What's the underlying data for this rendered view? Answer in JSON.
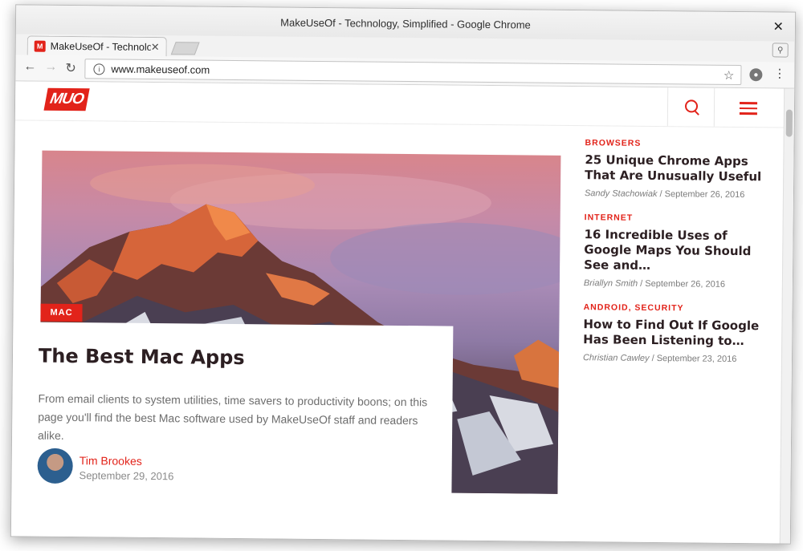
{
  "window": {
    "title": "MakeUseOf - Technology, Simplified - Google Chrome",
    "close_glyph": "✕"
  },
  "tab": {
    "favicon_text": "M",
    "title": "MakeUseOf - Technology, Simplified",
    "close_glyph": "✕"
  },
  "toolbar": {
    "back_glyph": "←",
    "forward_glyph": "→",
    "reload_glyph": "↻",
    "url": "www.makeuseof.com",
    "info_glyph": "i",
    "star_glyph": "☆",
    "menu_glyph": "⋮",
    "profile_glyph": "⚲"
  },
  "site": {
    "logo_text": "MUO",
    "brand_color": "#e2231a"
  },
  "featured": {
    "category": "MAC",
    "title": "The Best Mac Apps",
    "description": "From email clients to system utilities, time savers to productivity boons; on this page you'll find the best Mac software used by MakeUseOf staff and readers alike.",
    "author": "Tim Brookes",
    "date": "September 29, 2016"
  },
  "sidebar": {
    "items": [
      {
        "categories": [
          "BROWSERS"
        ],
        "title": "25 Unique Chrome Apps That Are Unusually Useful",
        "author": "Sandy Stachowiak",
        "date": "September 26, 2016"
      },
      {
        "categories": [
          "INTERNET"
        ],
        "title": "16 Incredible Uses of Google Maps You Should See and…",
        "author": "Briallyn Smith",
        "date": "September 26, 2016"
      },
      {
        "categories": [
          "ANDROID",
          "SECURITY"
        ],
        "title": "How to Find Out If Google Has Been Listening to…",
        "author": "Christian Cawley",
        "date": "September 23, 2016"
      }
    ]
  }
}
